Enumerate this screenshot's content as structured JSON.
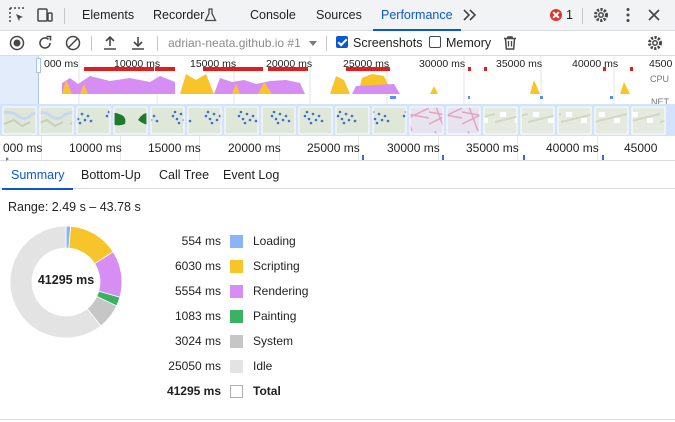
{
  "main_tabs": [
    {
      "label": "Elements"
    },
    {
      "label": "Recorder"
    },
    {
      "label": "Console"
    },
    {
      "label": "Sources"
    },
    {
      "label": "Performance"
    }
  ],
  "more_tabs_icon": "chevron-double-right-icon",
  "error_count": "1",
  "toolbar": {
    "recording_select": "adrian-neata.github.io #1",
    "screenshots_label": "Screenshots",
    "screenshots_checked": true,
    "memory_label": "Memory",
    "memory_checked": false
  },
  "overview": {
    "tick_labels": [
      "000 ms",
      "10000 ms",
      "15000 ms",
      "20000 ms",
      "25000 ms",
      "30000 ms",
      "35000 ms",
      "40000 ms",
      "4500"
    ],
    "cpu_label": "CPU",
    "net_label": "NET"
  },
  "ruler": {
    "tick_labels": [
      "000 ms",
      "10000 ms",
      "15000 ms",
      "20000 ms",
      "25000 ms",
      "30000 ms",
      "35000 ms",
      "40000 ms",
      "45000"
    ]
  },
  "detail_tabs": [
    {
      "label": "Summary"
    },
    {
      "label": "Bottom-Up"
    },
    {
      "label": "Call Tree"
    },
    {
      "label": "Event Log"
    }
  ],
  "summary": {
    "range": "Range: 2.49 s – 43.78 s",
    "total_center": "41295 ms",
    "categories": [
      {
        "value": "554 ms",
        "label": "Loading",
        "color": "#8ab4f8",
        "ms": 554
      },
      {
        "value": "6030 ms",
        "label": "Scripting",
        "color": "#f7c52a",
        "ms": 6030
      },
      {
        "value": "5554 ms",
        "label": "Rendering",
        "color": "#d68ef5",
        "ms": 5554
      },
      {
        "value": "1083 ms",
        "label": "Painting",
        "color": "#3bb163",
        "ms": 1083
      },
      {
        "value": "3024 ms",
        "label": "System",
        "color": "#c6c6c6",
        "ms": 3024
      },
      {
        "value": "25050 ms",
        "label": "Idle",
        "color": "#e3e3e3",
        "ms": 25050
      }
    ],
    "total": {
      "value": "41295 ms",
      "label": "Total"
    }
  }
}
